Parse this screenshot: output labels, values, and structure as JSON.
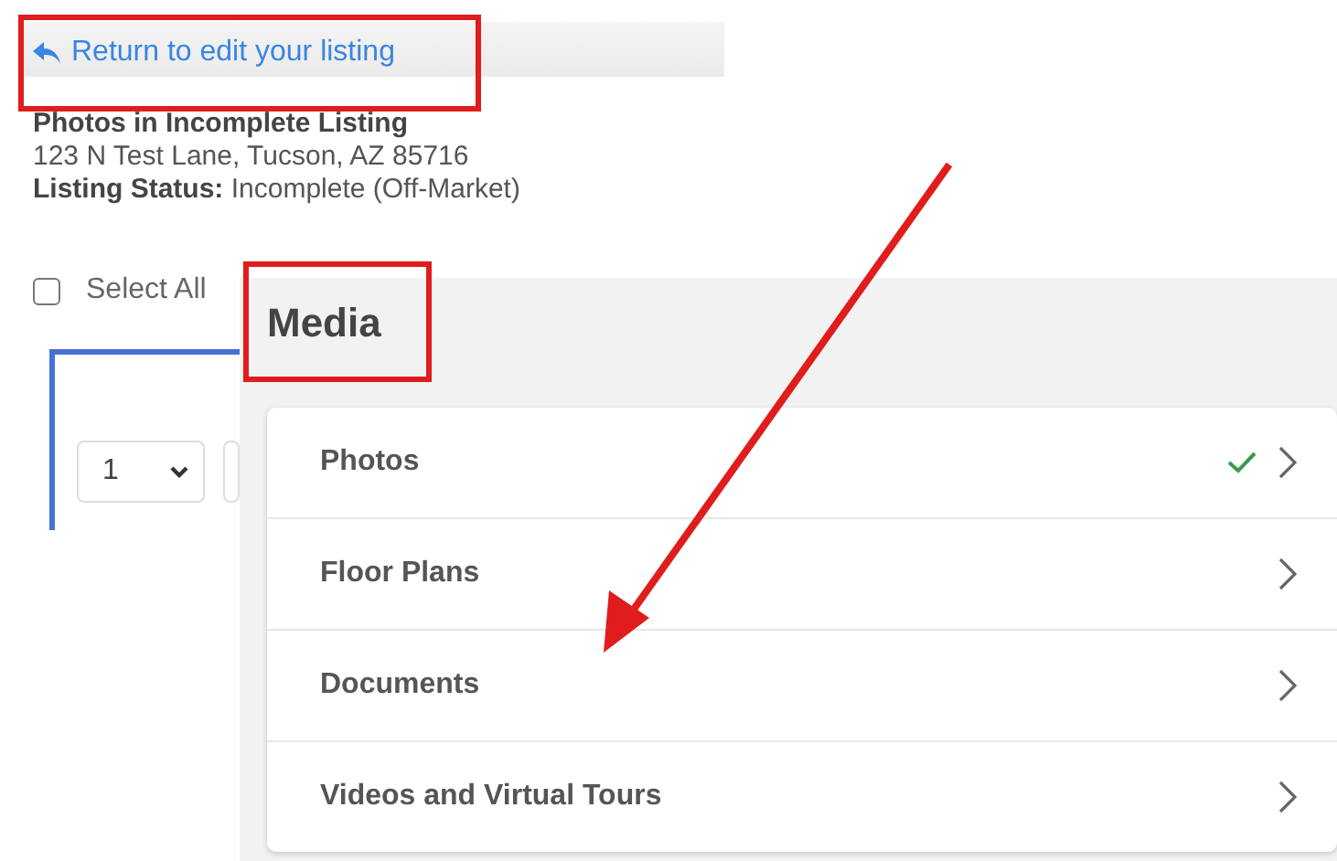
{
  "back_link": {
    "label": "Return to edit your listing"
  },
  "listing": {
    "title": "Photos in Incomplete Listing",
    "address": "123 N Test Lane, Tucson, AZ 85716",
    "status_label": "Listing Status:",
    "status_value": "Incomplete (Off-Market)"
  },
  "select_all": {
    "label": "Select All",
    "checked": false
  },
  "page_select": {
    "value": "1"
  },
  "media": {
    "title": "Media",
    "items": [
      {
        "label": "Photos",
        "complete": true
      },
      {
        "label": "Floor Plans",
        "complete": false
      },
      {
        "label": "Documents",
        "complete": false
      },
      {
        "label": "Videos and Virtual Tours",
        "complete": false
      }
    ]
  }
}
